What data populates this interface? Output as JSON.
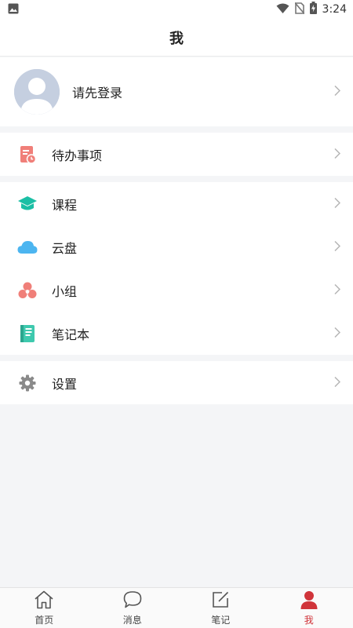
{
  "status": {
    "time": "3:24"
  },
  "header": {
    "title": "我"
  },
  "profile": {
    "login_label": "请先登录"
  },
  "menu": {
    "todo": "待办事项",
    "courses": "课程",
    "cloud": "云盘",
    "group": "小组",
    "notebook": "笔记本",
    "settings": "设置"
  },
  "tabs": [
    {
      "label": "首页",
      "icon": "home-icon"
    },
    {
      "label": "消息",
      "icon": "message-icon"
    },
    {
      "label": "笔记",
      "icon": "note-edit-icon"
    },
    {
      "label": "我",
      "icon": "person-icon",
      "active": true
    }
  ],
  "colors": {
    "accent": "#d0343a",
    "todo_icon": "#f07f79",
    "course_icon": "#1bbfa5",
    "cloud_icon": "#4cb5f0",
    "group_icon": "#f07f79",
    "notebook_icon": "#3ec9ae",
    "settings_icon": "#8a8a8a"
  }
}
